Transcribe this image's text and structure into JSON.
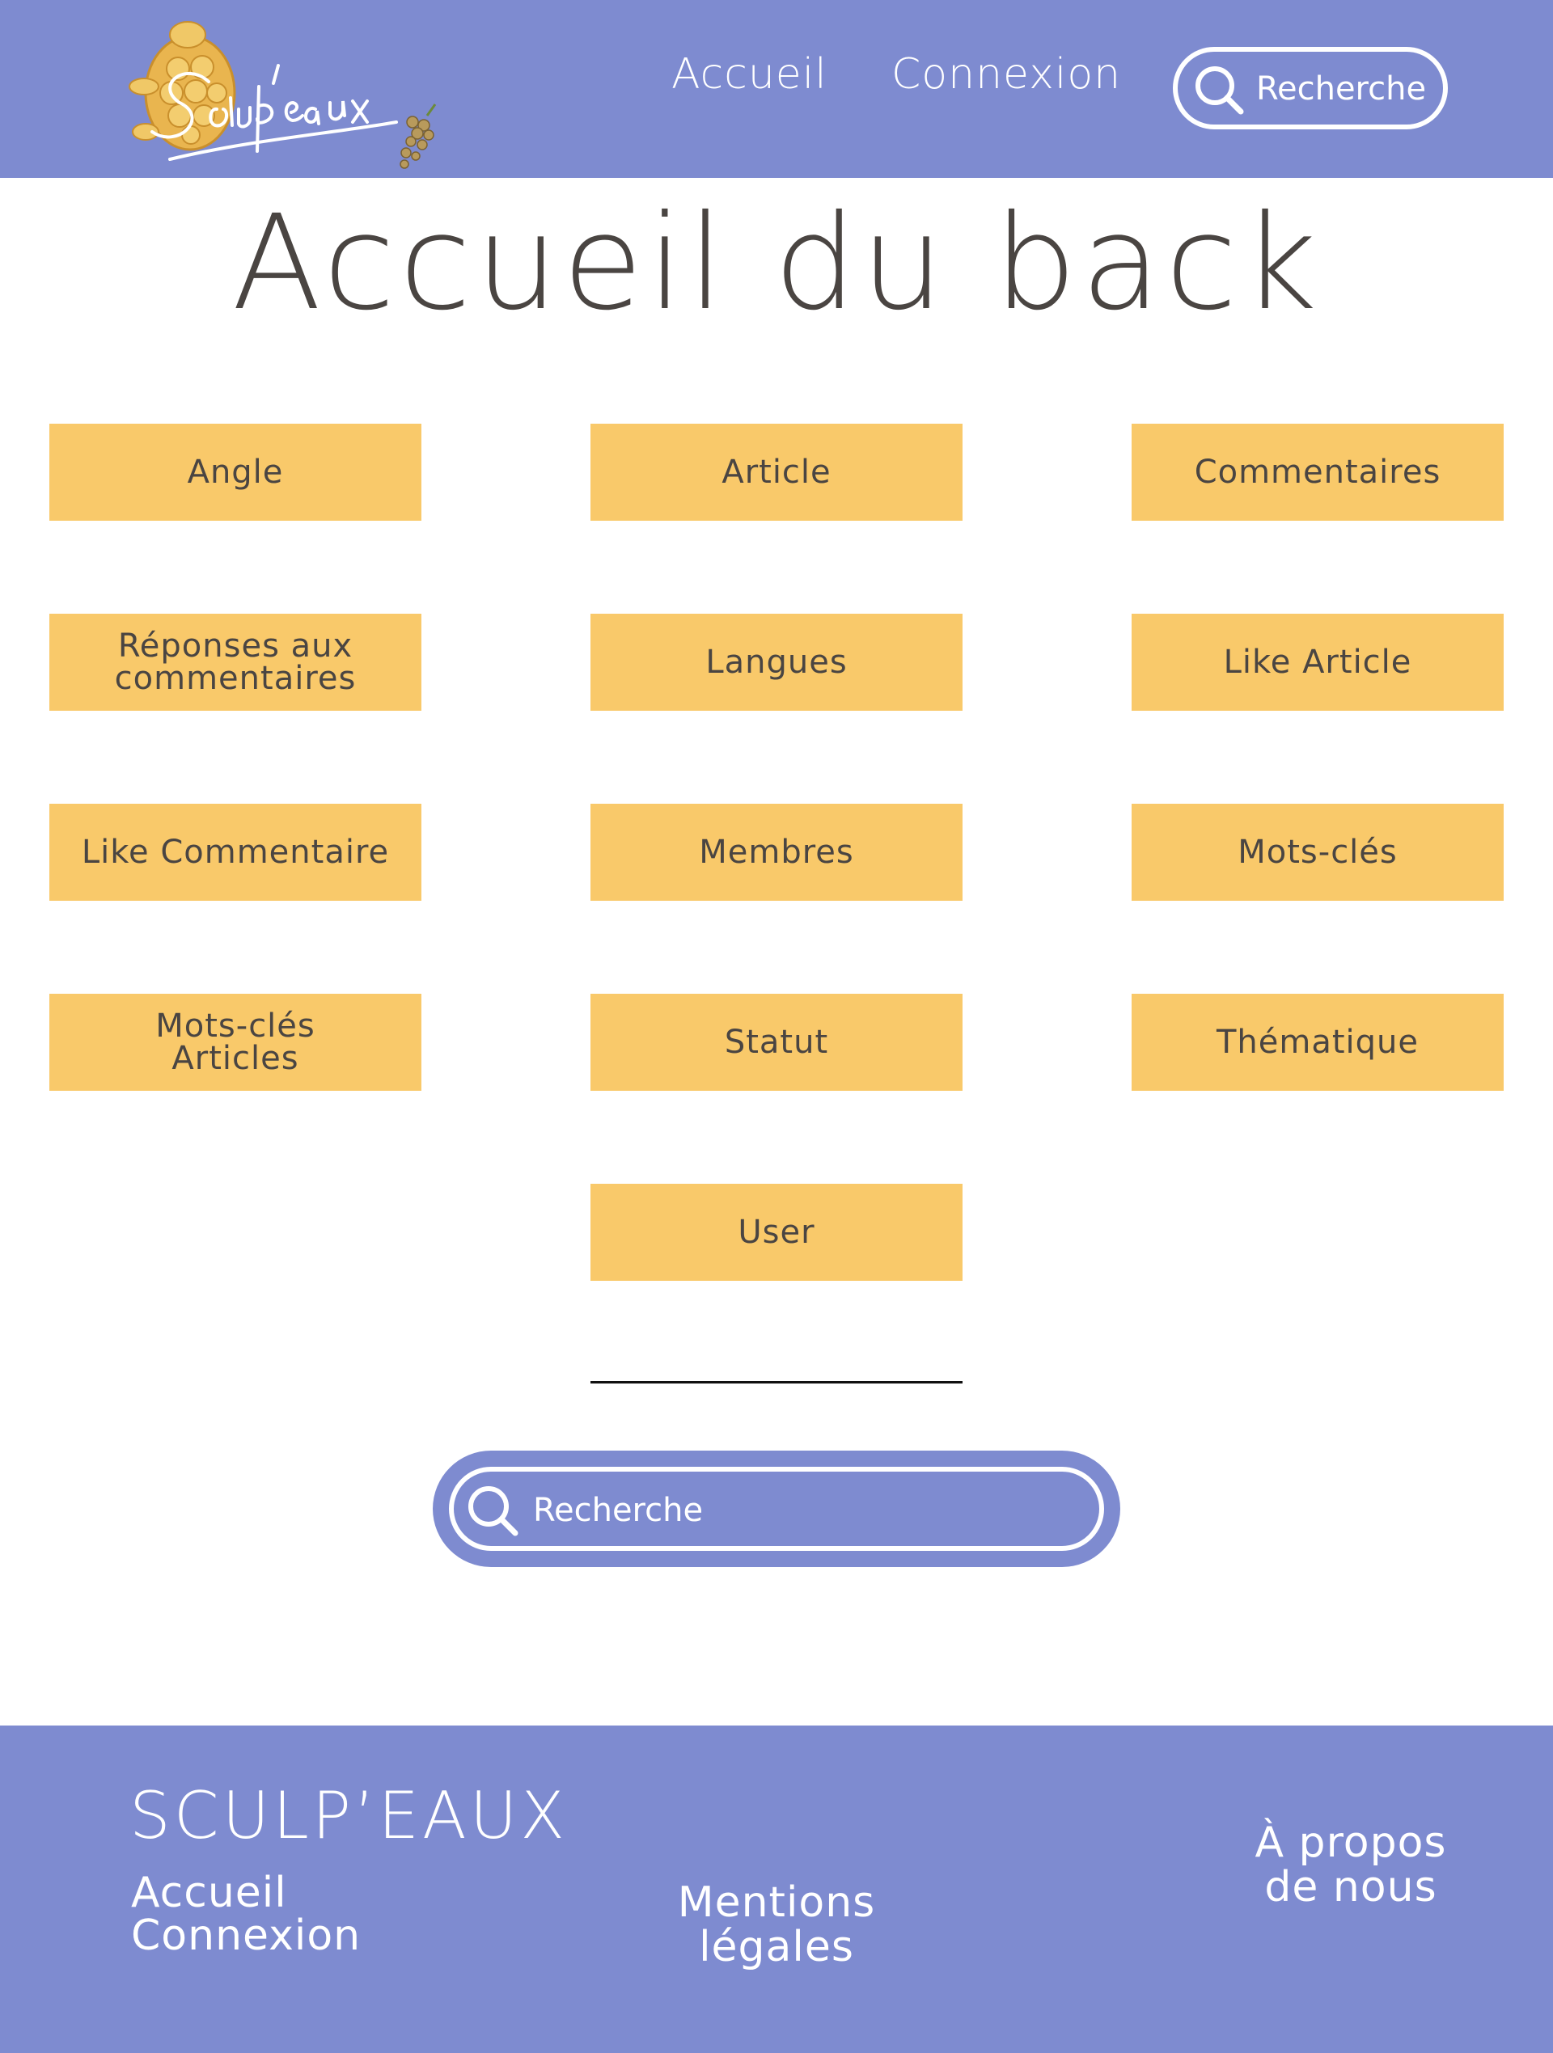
{
  "header": {
    "nav": {
      "home": "Accueil",
      "login": "Connexion"
    },
    "search_placeholder": "Recherche"
  },
  "page_title": "Accueil du back",
  "tiles": [
    "Angle",
    "Article",
    "Commentaires",
    "Réponses aux\ncommentaires",
    "Langues",
    "Like Article",
    "Like Commentaire",
    "Membres",
    "Mots-clés",
    "Mots-clés\nArticles",
    "Statut",
    "Thématique",
    "User"
  ],
  "search": {
    "placeholder": "Recherche"
  },
  "footer": {
    "brand": "SCULP’EAUX",
    "home": "Accueil",
    "login": "Connexion",
    "legal": "Mentions\nlégales",
    "about": "À propos\nde nous"
  },
  "colors": {
    "primary": "#7e8bd0",
    "tile": "#f9c96a",
    "text": "#4a4542"
  }
}
